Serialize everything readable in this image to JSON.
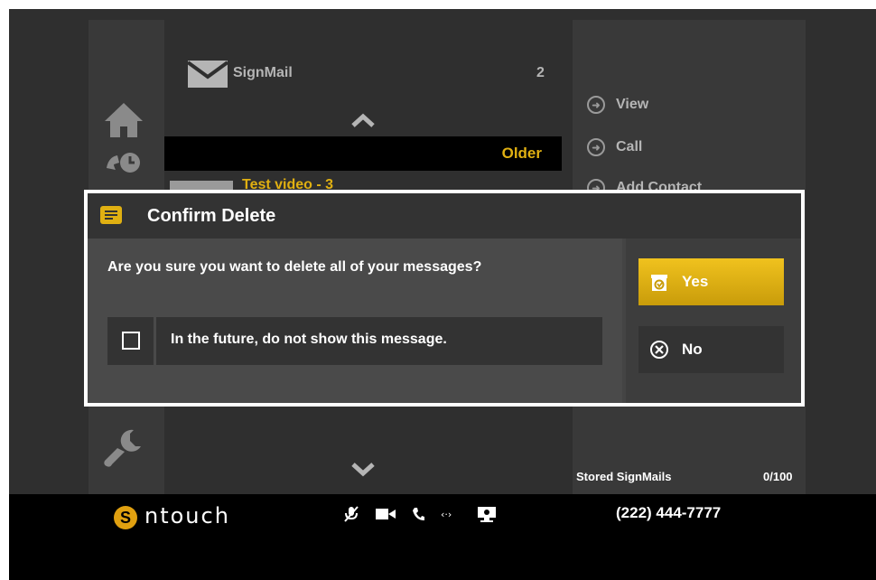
{
  "signmail": {
    "title": "SignMail",
    "count": "2"
  },
  "list": {
    "older_label": "Older",
    "first_item": "Test video - 3"
  },
  "actions": [
    {
      "label": "View"
    },
    {
      "label": "Call"
    },
    {
      "label": "Add Contact"
    }
  ],
  "storage": {
    "label": "Stored SignMails",
    "count": "0/100"
  },
  "dialog": {
    "title": "Confirm Delete",
    "message": "Are you sure you want to delete all of your messages?",
    "checkbox_label": "In the future, do not show this message.",
    "checkbox_checked": false,
    "yes_label": "Yes",
    "no_label": "No"
  },
  "footer": {
    "brand": "ntouch",
    "phone": "(222) 444-7777"
  },
  "colors": {
    "accent": "#e0b012",
    "background": "#2f2f2f",
    "bar": "#000000"
  },
  "icons": [
    "envelope-icon",
    "home-icon",
    "call-history-icon",
    "wrench-icon",
    "chevron-up-icon",
    "chevron-down-icon",
    "mic-muted-icon",
    "video-icon",
    "phone-icon",
    "signal-icon",
    "display-icon",
    "message-icon",
    "delete-icon",
    "close-circle-icon"
  ]
}
